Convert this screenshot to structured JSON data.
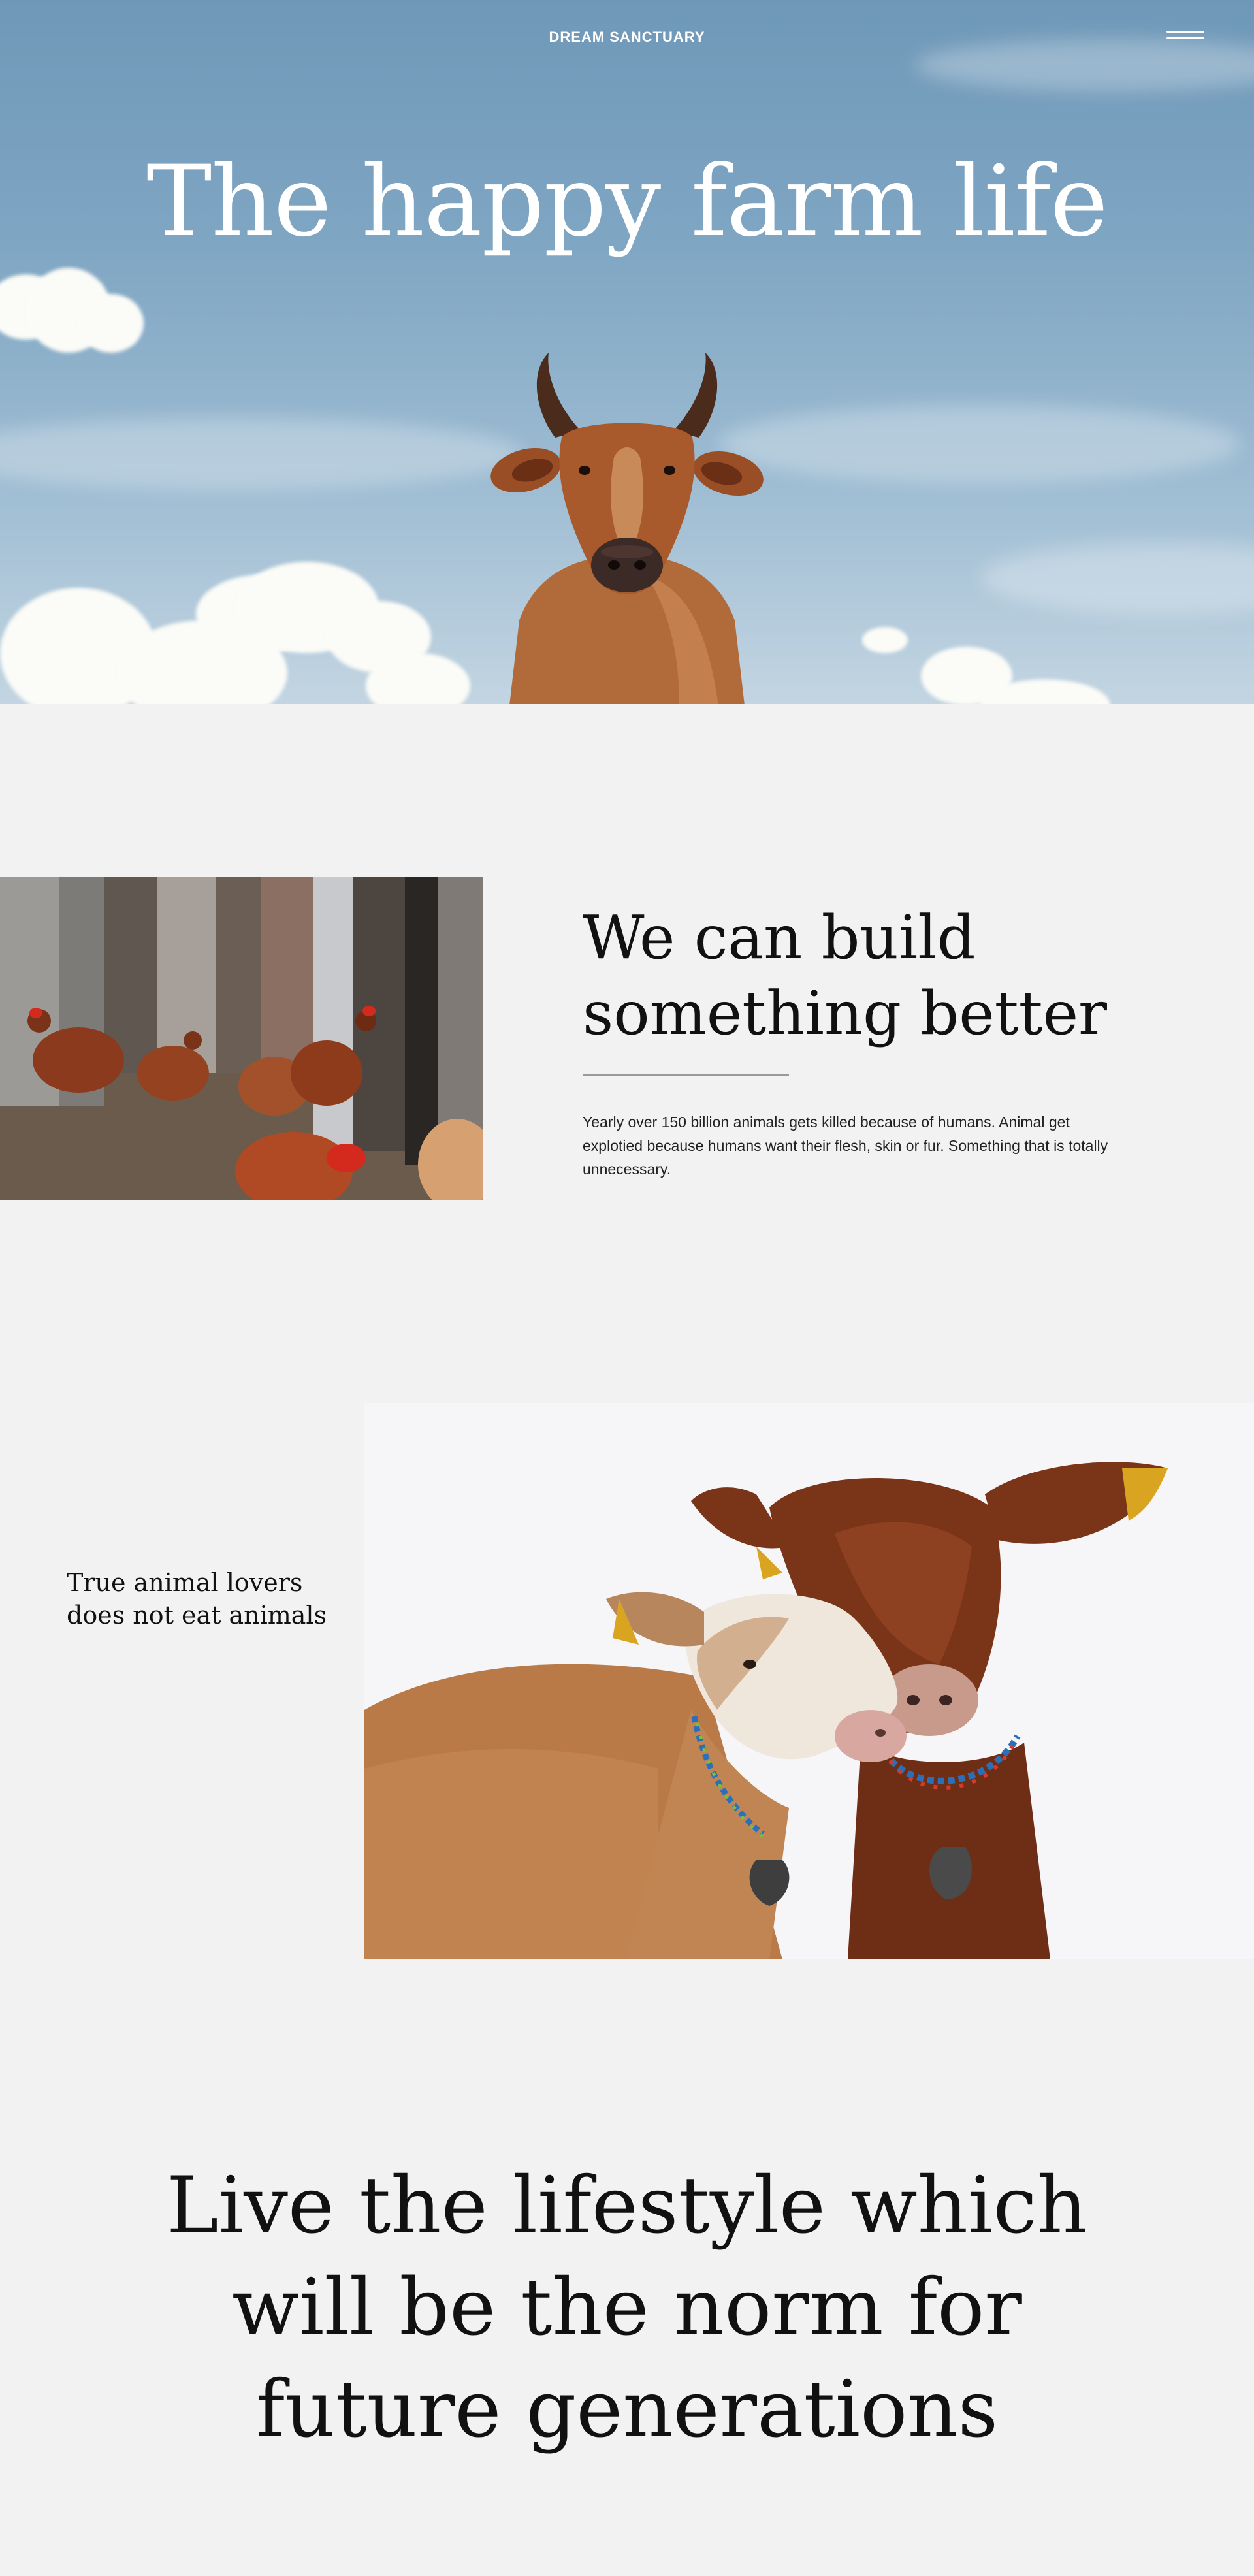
{
  "header": {
    "brand": "DREAM SANCTUARY",
    "menu_icon": "hamburger-menu-icon"
  },
  "hero": {
    "title": "The happy farm life"
  },
  "section_build": {
    "heading": "We can build something better",
    "body": "Yearly over 150 billion animals gets killed because of humans. Animal get explotied because humans want their flesh, skin or fur. Something that is totally unnecessary."
  },
  "section_quote": {
    "text": "True animal lovers does not eat animals"
  },
  "section_closing": {
    "text": "Live the lifestyle which will be the norm for future generations"
  },
  "colors": {
    "page_background": "#f2f2f2",
    "sky": "#7fa6c3",
    "text": "#111111",
    "hero_text": "#ffffff"
  }
}
